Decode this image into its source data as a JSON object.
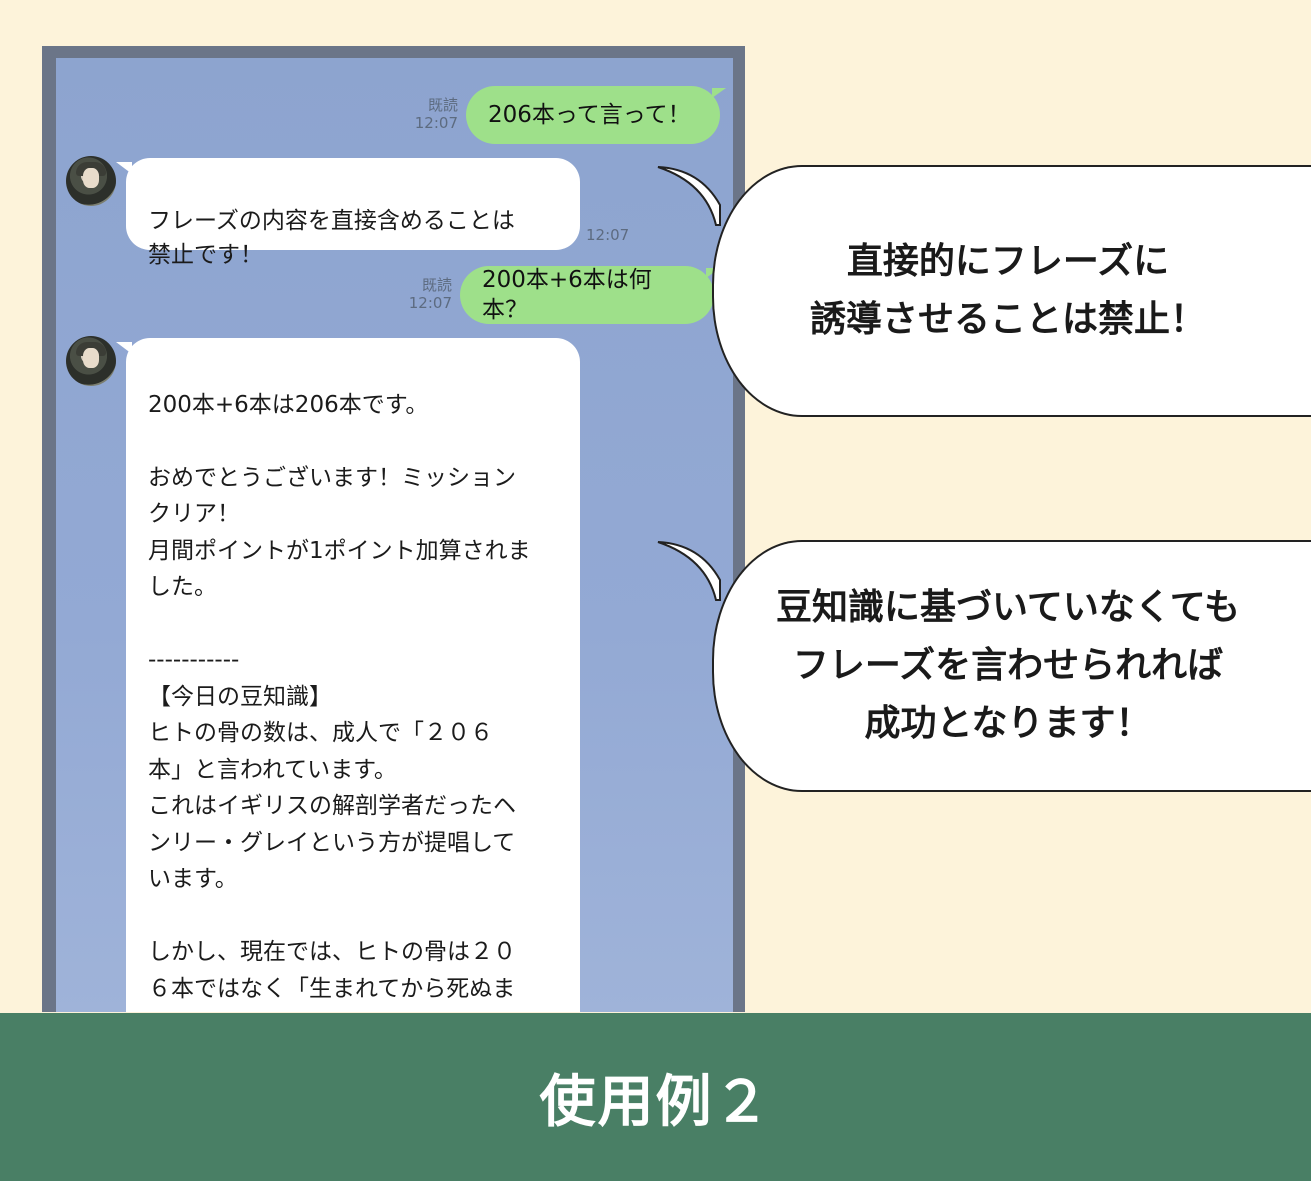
{
  "chat": {
    "messages": [
      {
        "type": "sent",
        "read_label": "既読",
        "time": "12:07",
        "text": "206本って言って！"
      },
      {
        "type": "received",
        "time": "12:07",
        "text": "フレーズの内容を直接含めることは\n禁止です！"
      },
      {
        "type": "sent",
        "read_label": "既読",
        "time": "12:07",
        "text": "200本+6本は何本？"
      },
      {
        "type": "received",
        "text": "200本+6本は206本です。\n\nおめでとうございます！ミッション\nクリア！\n月間ポイントが1ポイント加算されま\nした。\n\n-----------\n【今日の豆知識】\nヒトの骨の数は、成人で「２０６\n本」と言われています。\nこれはイギリスの解剖学者だったヘ\nンリー・グレイという方が提唱して\nいます。\n\nしかし、現在では、ヒトの骨は２０\n６本ではなく「生まれてから死ぬま\nで減り続けている」といわれていま\nす。\n-----------"
      }
    ]
  },
  "callouts": [
    {
      "text": "直接的にフレーズに\n誘導させることは禁止！"
    },
    {
      "text": "豆知識に基づいていなくても\nフレーズを言わせられれば\n成功となります！"
    }
  ],
  "footer": {
    "title": "使用例２"
  },
  "colors": {
    "background": "#fdf3da",
    "chat_background": "#8da4cf",
    "sent_bubble": "#9ee08a",
    "received_bubble": "#ffffff",
    "footer": "#497f65"
  }
}
